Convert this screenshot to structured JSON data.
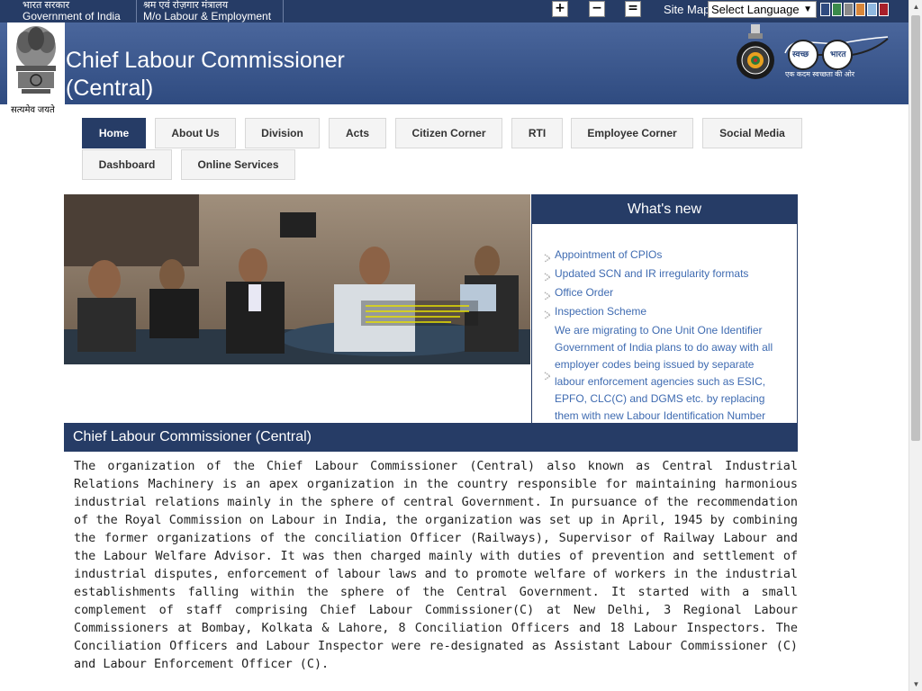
{
  "topbar": {
    "gov_hindi": "भारत सरकार",
    "gov_english": "Government of India",
    "ministry_hindi": "श्रम एवं रोज़गार मंत्रालय",
    "ministry_english": "M/o Labour & Employment",
    "font_increase": "+",
    "font_decrease": "−",
    "font_normal": "=",
    "sitemap": "Site Map",
    "language_select": "Select Language",
    "theme_colors": [
      "#2f4b80",
      "#3a8a4a",
      "#8a8a8a",
      "#d9873a",
      "#8fb8e0",
      "#a81f2a"
    ]
  },
  "header": {
    "title_line1": "Chief Labour Commissioner",
    "title_line2": "(Central)",
    "motto": "सत्यमेव जयते",
    "swachh_text": "स्वच्छ",
    "bharat_text": "भारत",
    "swachh_tagline": "एक कदम स्वच्छता की ओर"
  },
  "nav": {
    "items": [
      {
        "label": "Home",
        "active": true
      },
      {
        "label": "About Us",
        "active": false
      },
      {
        "label": "Division",
        "active": false
      },
      {
        "label": "Acts",
        "active": false
      },
      {
        "label": "Citizen Corner",
        "active": false
      },
      {
        "label": "RTI",
        "active": false
      },
      {
        "label": "Employee Corner",
        "active": false
      },
      {
        "label": "Social Media",
        "active": false
      },
      {
        "label": "Dashboard",
        "active": false
      },
      {
        "label": "Online Services",
        "active": false
      }
    ]
  },
  "whats_new": {
    "title": "What's new",
    "items": [
      "Appointment of CPIOs",
      "Updated SCN and IR irregularity formats",
      "Office Order",
      "Inspection Scheme",
      "We are migrating to One Unit One Identifier Government of India plans to do away with all employer codes being issued by separate labour enforcement agencies such as ESIC, EPFO, CLC(C) and DGMS etc. by replacing them with new Labour Identification Number"
    ]
  },
  "about": {
    "title": "Chief Labour Commissioner (Central)",
    "text": "The organization of the Chief Labour Commissioner (Central) also known as Central Industrial Relations Machinery is an apex organization in the country responsible for maintaining harmonious industrial relations mainly in the sphere of central Government. In pursuance of the recommendation of the Royal Commission on Labour in India, the organization was set up in April, 1945 by combining the former organizations of the conciliation Officer (Railways), Supervisor of Railway Labour and the Labour Welfare Advisor. It was then charged mainly with duties of prevention and settlement of industrial disputes, enforcement of labour laws and to promote welfare of workers in the industrial establishments falling within the sphere of the Central Government. It started with a small complement of staff comprising Chief Labour Commissioner(C) at New Delhi, 3 Regional Labour Commissioners at Bombay, Kolkata & Lahore, 8 Conciliation Officers and 18 Labour Inspectors. The Conciliation Officers and Labour Inspector were re-designated as Assistant Labour Commissioner (C) and Labour Enforcement Officer (C)."
  }
}
